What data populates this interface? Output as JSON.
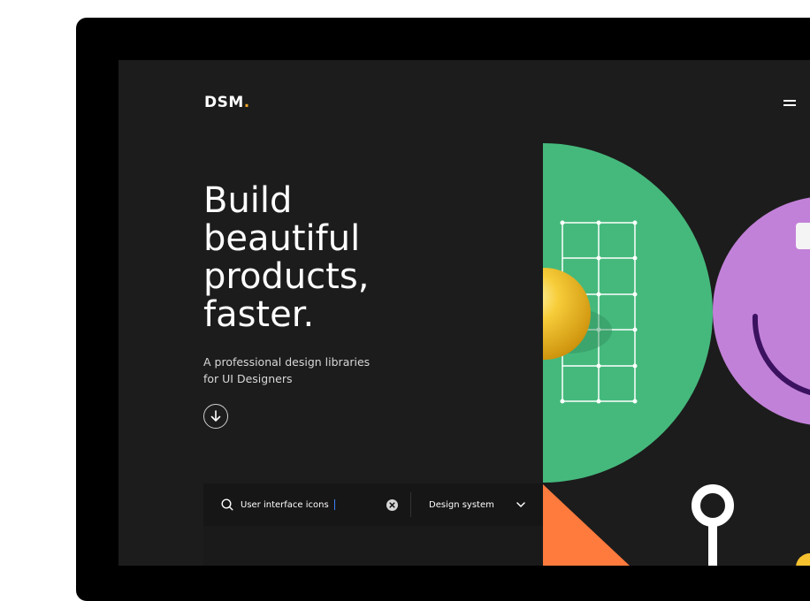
{
  "brand": {
    "name": "DSM",
    "dot": "."
  },
  "hero": {
    "title_lines": [
      "Build",
      "beautiful",
      "products,",
      "faster."
    ],
    "subtitle_lines": [
      "A professional design libraries",
      "for UI Designers"
    ]
  },
  "search": {
    "value": "User interface icons",
    "category": "Design system"
  },
  "colors": {
    "background": "#1c1c1c",
    "accent": "#f5a623",
    "green": "#45b97c",
    "purple": "#c281d9",
    "yellow": "#f6c230",
    "orange": "#ff7a3d"
  },
  "icons": {
    "menu": "hamburger-icon",
    "scroll": "arrow-down-icon",
    "search": "search-icon",
    "clear": "close-circle-icon",
    "dropdown": "chevron-down-icon"
  }
}
